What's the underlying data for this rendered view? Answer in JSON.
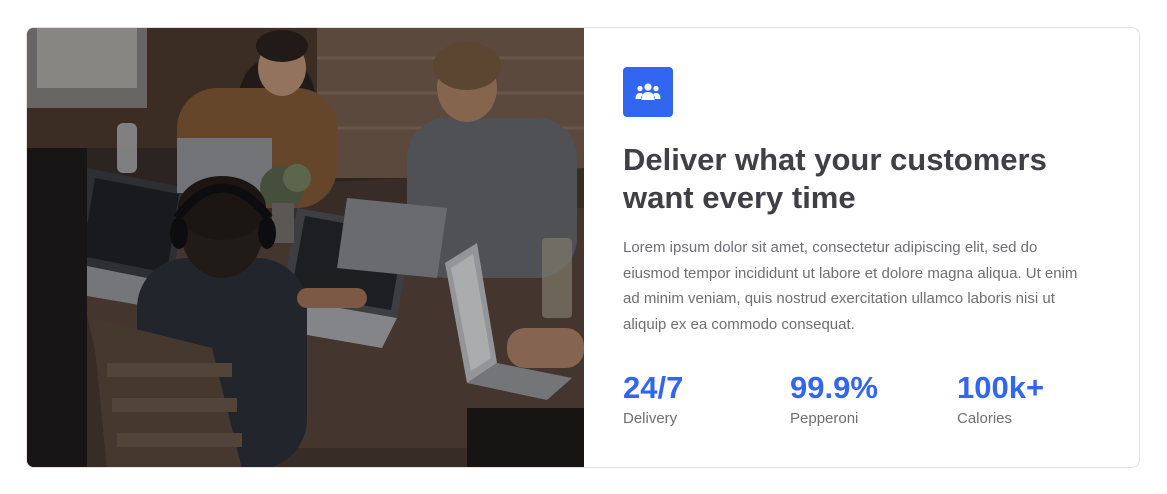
{
  "feature": {
    "icon": "users-group-icon",
    "title": "Deliver what your customers want every time",
    "description": "Lorem ipsum dolor sit amet, consectetur adipiscing elit, sed do eiusmod tempor incididunt ut labore et dolore magna aliqua. Ut enim ad minim veniam, quis nostrud exercitation ullamco laboris nisi ut aliquip ex ea commodo consequat."
  },
  "stats": [
    {
      "value": "24/7",
      "label": "Delivery"
    },
    {
      "value": "99.9%",
      "label": "Pepperoni"
    },
    {
      "value": "100k+",
      "label": "Calories"
    }
  ],
  "colors": {
    "accent": "#3366f0",
    "heading": "#3f3f45",
    "body": "#6e6e74"
  }
}
